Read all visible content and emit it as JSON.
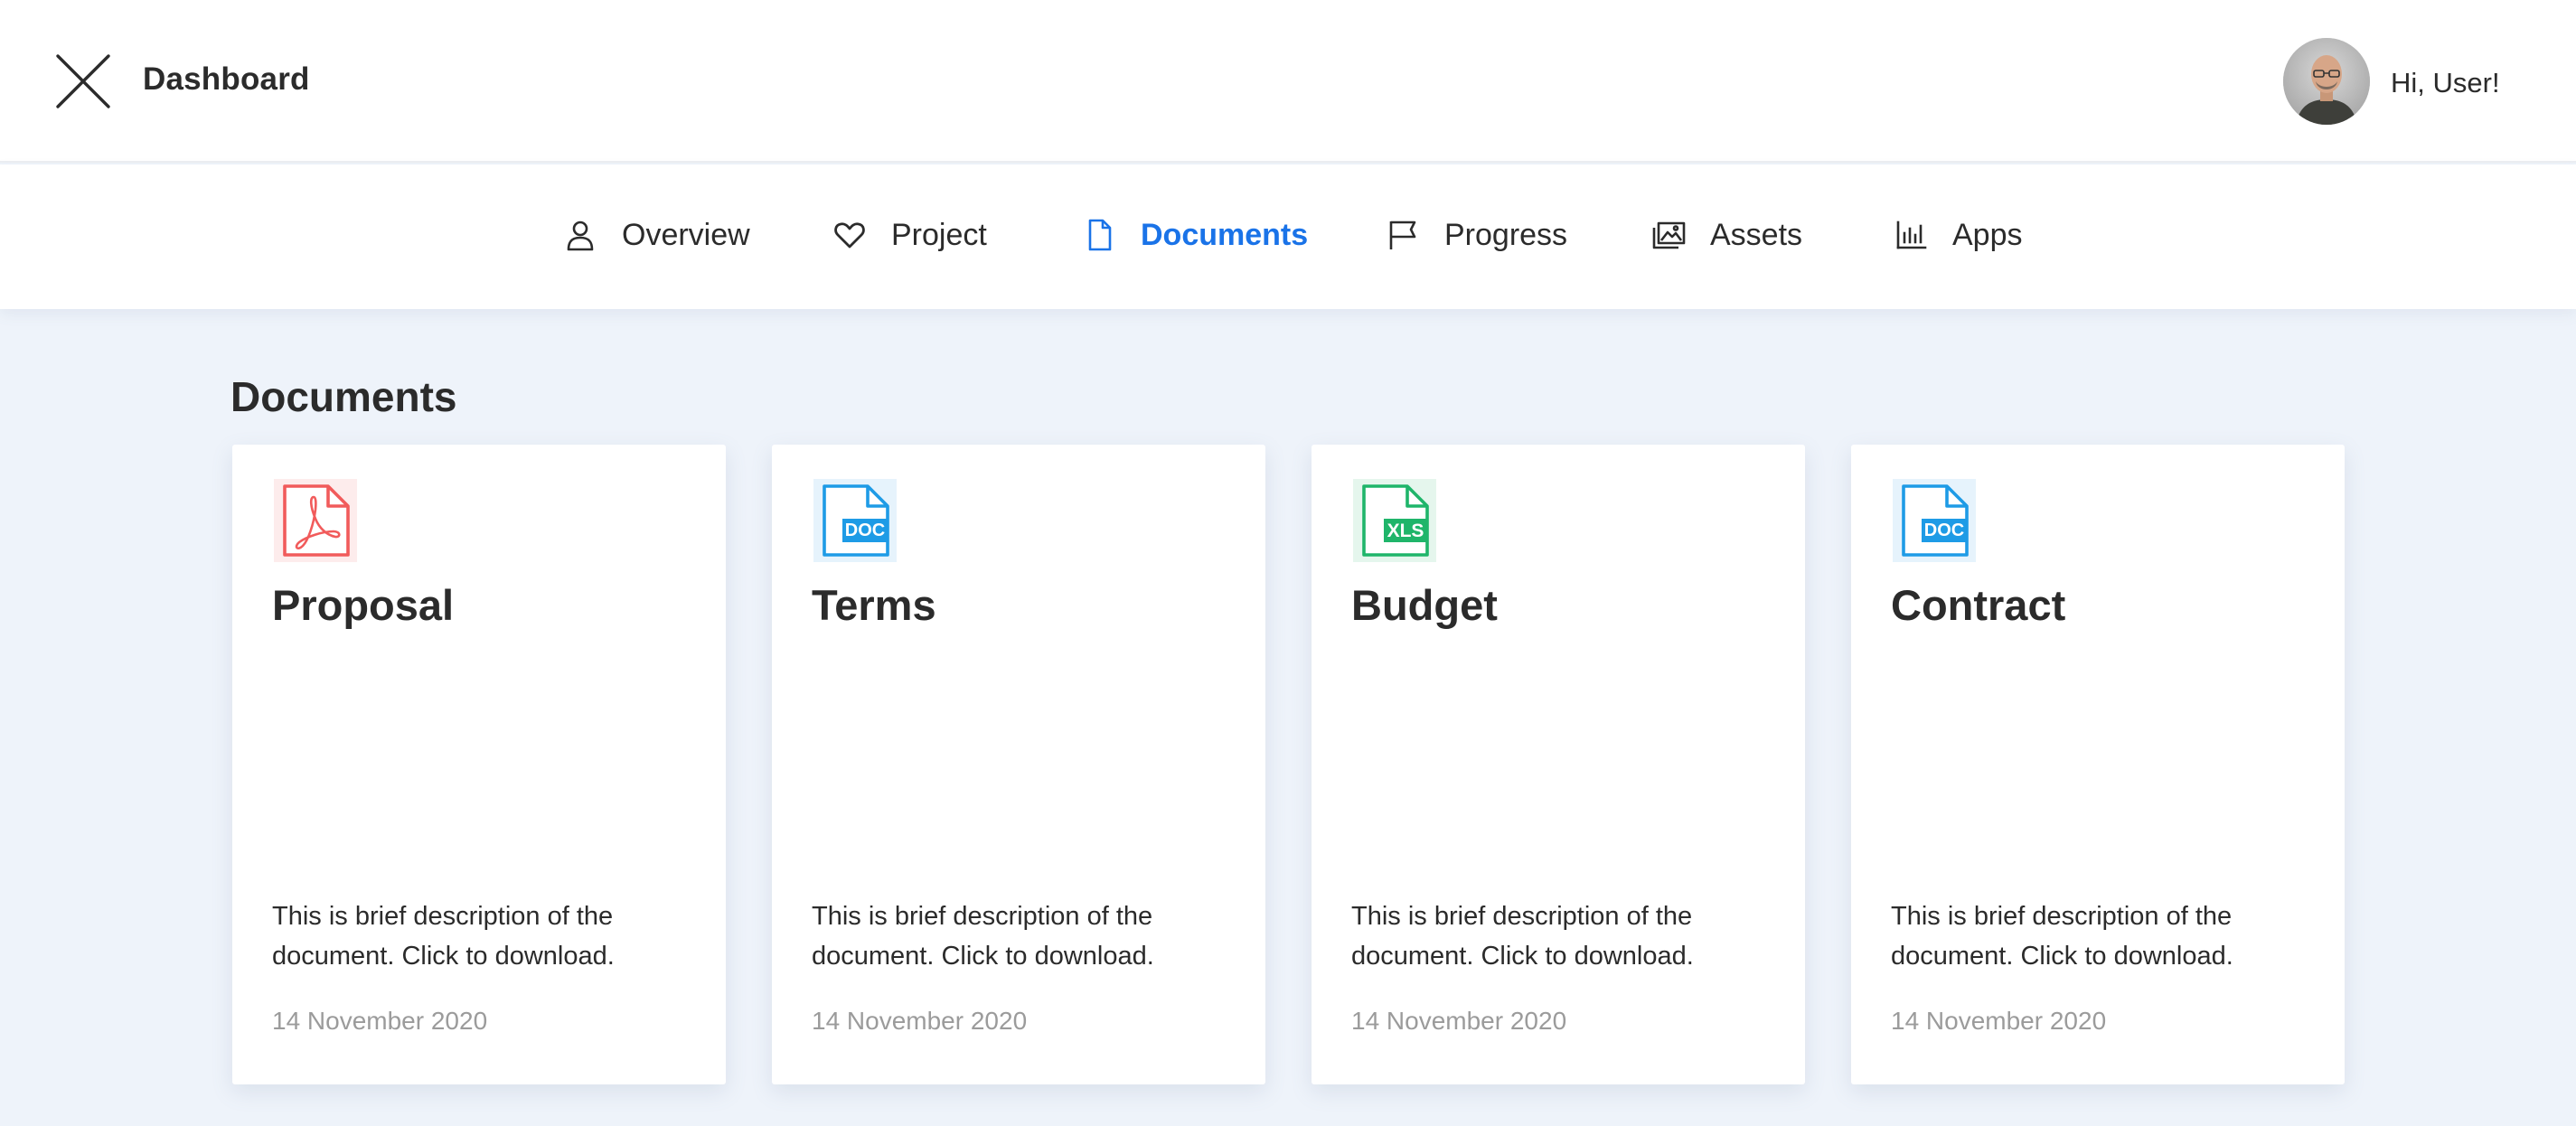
{
  "header": {
    "title": "Dashboard",
    "greeting": "Hi, User!"
  },
  "nav": {
    "items": [
      {
        "label": "Overview",
        "icon": "user-icon"
      },
      {
        "label": "Project",
        "icon": "heart-icon"
      },
      {
        "label": "Documents",
        "icon": "file-icon",
        "active": true
      },
      {
        "label": "Progress",
        "icon": "flag-icon"
      },
      {
        "label": "Assets",
        "icon": "images-icon"
      },
      {
        "label": "Apps",
        "icon": "bar-chart-icon"
      }
    ]
  },
  "main": {
    "section_title": "Documents",
    "cards": [
      {
        "title": "Proposal",
        "file_type": "PDF",
        "icon": "pdf-file-icon",
        "color": "#f15b5b",
        "description": "This is brief description of the document. Click to download.",
        "date": "14 November 2020"
      },
      {
        "title": "Terms",
        "file_type": "DOC",
        "icon": "doc-file-icon",
        "color": "#1e9be6",
        "description": "This is brief description of the document. Click to download.",
        "date": "14 November 2020"
      },
      {
        "title": "Budget",
        "file_type": "XLS",
        "icon": "xls-file-icon",
        "color": "#1fb56a",
        "description": "This is brief description of the document. Click to download.",
        "date": "14 November 2020"
      },
      {
        "title": "Contract",
        "file_type": "DOC",
        "icon": "doc-file-icon",
        "color": "#1e9be6",
        "description": "This is brief description of the document. Click to download.",
        "date": "14 November 2020"
      }
    ]
  },
  "colors": {
    "accent": "#1a73e8",
    "background": "#eef3fa"
  }
}
